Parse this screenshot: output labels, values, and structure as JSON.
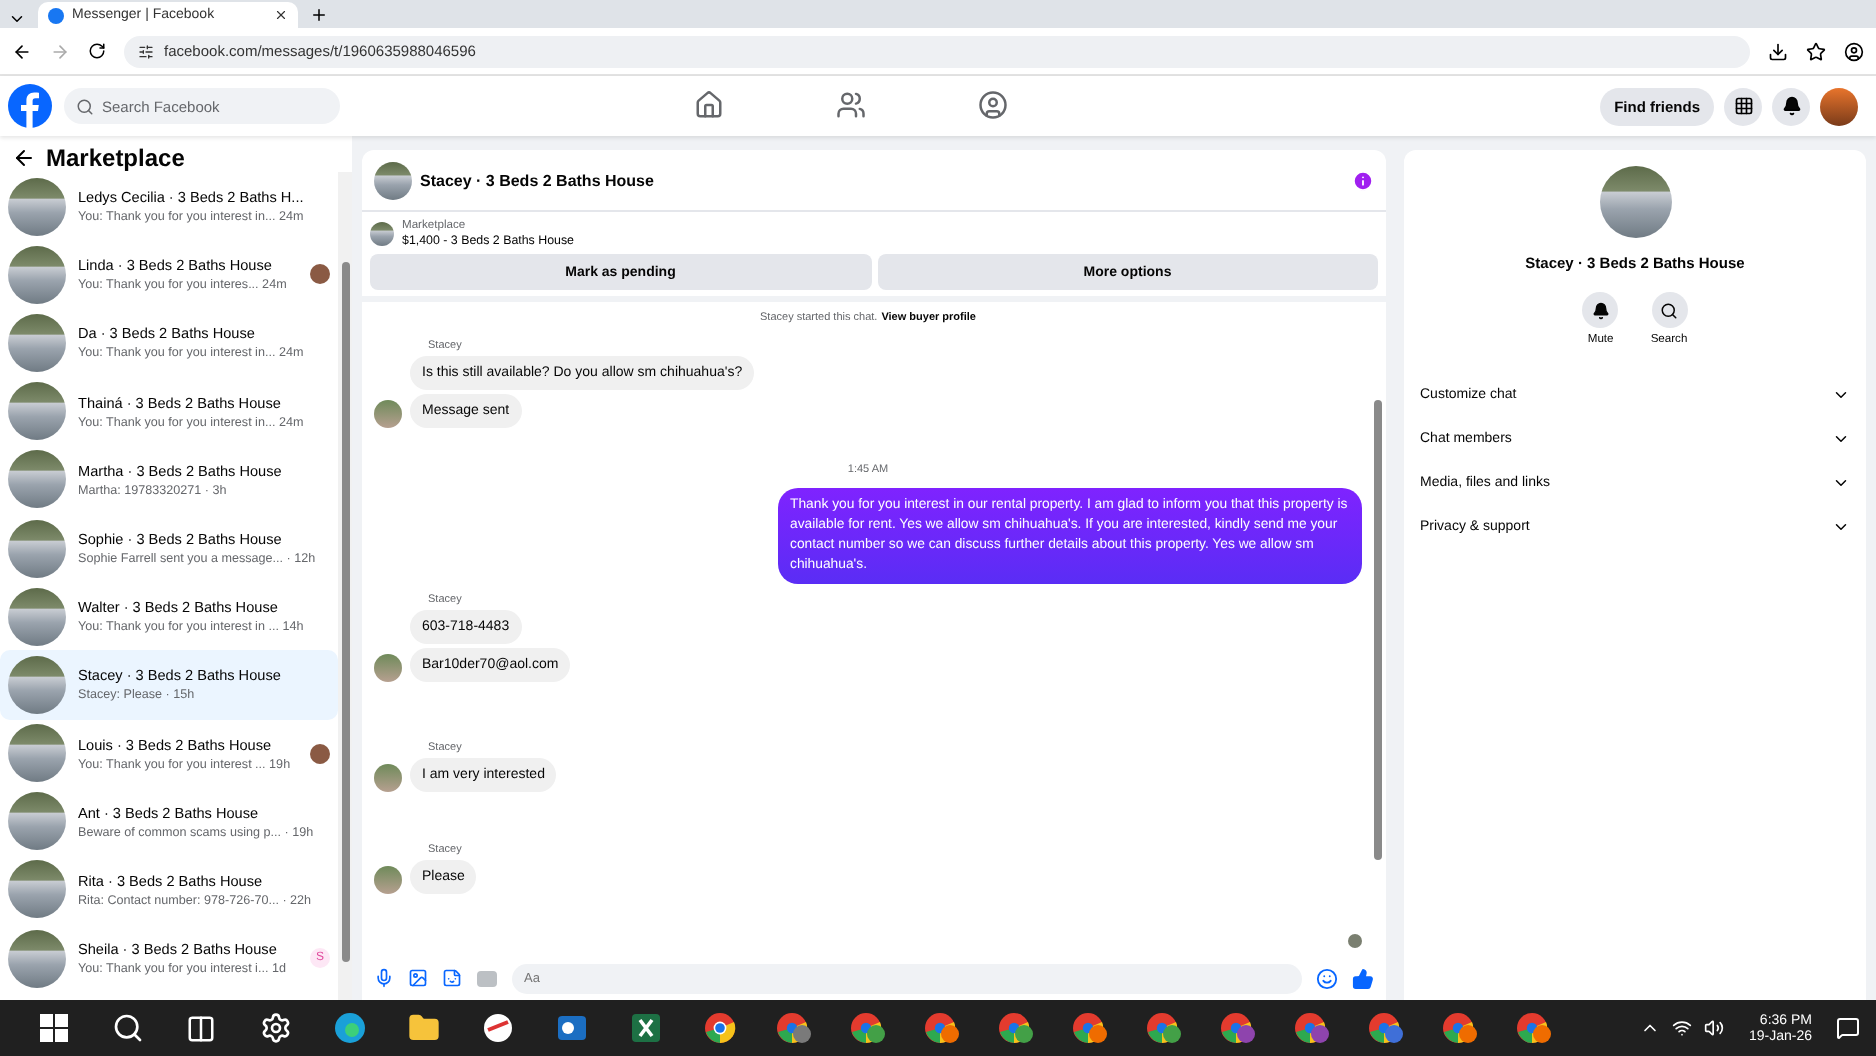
{
  "browser": {
    "tab_title": "Messenger | Facebook",
    "url": "facebook.com/messages/t/1960635988046596"
  },
  "header": {
    "search_placeholder": "Search Facebook",
    "find_friends": "Find friends",
    "nav": [
      {
        "kind": "home",
        "selected": false
      },
      {
        "kind": "friends",
        "selected": false
      },
      {
        "kind": "groups",
        "selected": false
      }
    ]
  },
  "sidebar": {
    "title": "Marketplace",
    "conversations": [
      {
        "title": "Ledys Cecilia · 3 Beds 2 Baths H...",
        "preview": "You: Thank you for you interest in... 24m",
        "selected": false
      },
      {
        "title": "Linda · 3 Beds 2 Baths House",
        "preview": "You: Thank you for you interes... 24m",
        "selected": false,
        "receipt": {
          "kind": "avatar"
        }
      },
      {
        "title": "Da · 3 Beds 2 Baths House",
        "preview": "You: Thank you for you interest in... 24m",
        "selected": false
      },
      {
        "title": "Thainá · 3 Beds 2 Baths House",
        "preview": "You: Thank you for you interest in... 24m",
        "selected": false
      },
      {
        "title": "Martha · 3 Beds 2 Baths House",
        "preview": "Martha: 19783320271 · 3h",
        "selected": false
      },
      {
        "title": "Sophie · 3 Beds 2 Baths House",
        "preview": "Sophie Farrell sent you a message... · 12h",
        "selected": false
      },
      {
        "title": "Walter · 3 Beds 2 Baths House",
        "preview": "You: Thank you for you interest in ... 14h",
        "selected": false
      },
      {
        "title": "Stacey · 3 Beds 2 Baths House",
        "preview": "Stacey: Please · 15h",
        "selected": true
      },
      {
        "title": "Louis · 3 Beds 2 Baths House",
        "preview": "You: Thank you for you interest ... 19h",
        "selected": false,
        "receipt": {
          "kind": "avatar"
        }
      },
      {
        "title": "Ant · 3 Beds 2 Baths House",
        "preview": "Beware of common scams using p... · 19h",
        "selected": false
      },
      {
        "title": "Rita · 3 Beds 2 Baths House",
        "preview": "Rita: Contact number: 978-726-70... · 22h",
        "selected": false
      },
      {
        "title": "Sheila · 3 Beds 2 Baths House",
        "preview": "You: Thank you for you interest i... 1d",
        "selected": false,
        "receipt": {
          "kind": "letter",
          "text": "S"
        }
      }
    ]
  },
  "chat": {
    "title": "Stacey · 3 Beds 2 Baths House",
    "listing": {
      "label": "Marketplace",
      "name": "$1,400 - 3 Beds 2 Baths House"
    },
    "buttons": [
      "Mark as pending",
      "More options"
    ],
    "messages": [
      {
        "kind": "system",
        "text": "Stacey started this chat.",
        "link": "View buyer profile"
      },
      {
        "kind": "incoming",
        "sender": "Stacey",
        "texts": [
          "Is this still available? Do you allow sm chihuahua's?",
          "Message sent"
        ]
      },
      {
        "kind": "time",
        "text": "1:45 AM"
      },
      {
        "kind": "outgoing",
        "texts": [
          "Thank you for you interest in our rental property. I am glad to inform you that this property is available for rent. Yes we allow sm chihuahua's. If you are interested, kindly send me your contact number so we can discuss further details about this property. Yes we allow sm chihuahua's."
        ]
      },
      {
        "kind": "incoming",
        "sender": "Stacey",
        "texts": [
          "603-718-4483",
          "Bar10der70@aol.com"
        ]
      },
      {
        "kind": "incoming",
        "sender": "Stacey",
        "texts": [
          "I am very interested"
        ]
      },
      {
        "kind": "incoming",
        "sender": "Stacey",
        "texts": [
          "Please"
        ]
      }
    ],
    "composer_placeholder": "Aa"
  },
  "details": {
    "title": "Stacey · 3 Beds 2 Baths House",
    "actions": [
      {
        "kind": "mute",
        "label": "Mute"
      },
      {
        "kind": "search",
        "label": "Search"
      }
    ],
    "sections": [
      {
        "label": "Customize chat",
        "expanded": false
      },
      {
        "label": "Chat members",
        "expanded": false
      },
      {
        "label": "Media, files and links",
        "expanded": false
      },
      {
        "label": "Privacy & support",
        "expanded": false
      }
    ]
  },
  "taskbar": {
    "apps": [
      {
        "kind": "start"
      },
      {
        "kind": "search"
      },
      {
        "kind": "taskview"
      },
      {
        "kind": "settings"
      },
      {
        "kind": "edge"
      },
      {
        "kind": "folder"
      },
      {
        "kind": "snip"
      },
      {
        "kind": "outlook"
      },
      {
        "kind": "excel"
      },
      {
        "kind": "chrome"
      },
      {
        "kind": "chrome-profile",
        "color": "#7a7a7a"
      },
      {
        "kind": "chrome-profile",
        "color": "#43a047"
      },
      {
        "kind": "chrome-profile",
        "color": "#ef6c00"
      },
      {
        "kind": "chrome-profile",
        "color": "#43a047"
      },
      {
        "kind": "chrome-profile",
        "color": "#ef6c00"
      },
      {
        "kind": "chrome-profile",
        "color": "#43a047"
      },
      {
        "kind": "chrome-profile",
        "color": "#8e44ad"
      },
      {
        "kind": "chrome-profile",
        "color": "#8e44ad"
      },
      {
        "kind": "chrome-profile",
        "color": "#3f6fd8"
      },
      {
        "kind": "chrome-profile",
        "color": "#ef6c00"
      },
      {
        "kind": "chrome-profile",
        "color": "#ef6c00"
      }
    ],
    "time": "6:36 PM",
    "date": "19-Jan-26"
  }
}
